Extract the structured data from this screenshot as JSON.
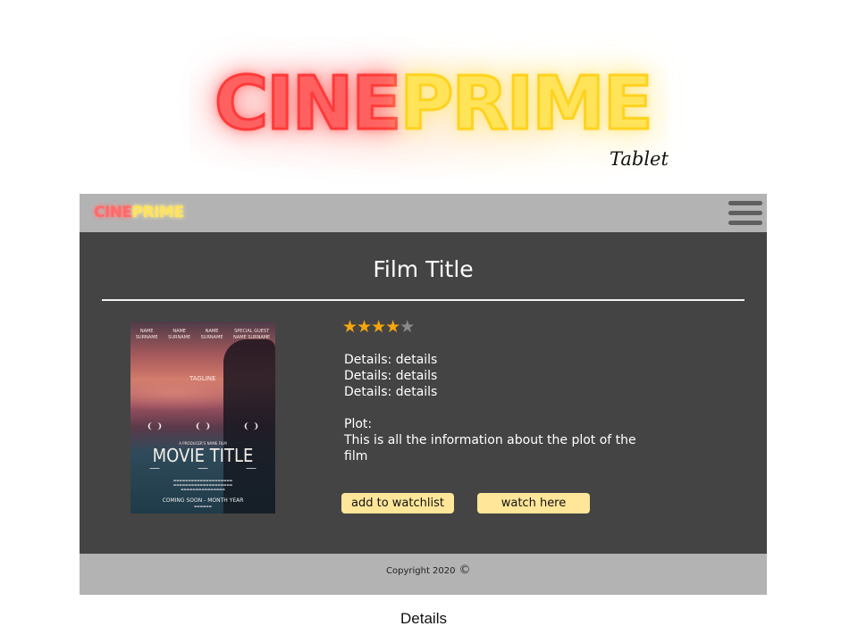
{
  "hero": {
    "logo_part1": "CINE",
    "logo_part2": "PRIME",
    "device_label": "Tablet"
  },
  "navbar": {
    "logo_part1": "CINE",
    "logo_part2": "PRIME",
    "menu_icon": "hamburger-menu-icon"
  },
  "film": {
    "title": "Film Title",
    "rating": 4,
    "rating_max": 5,
    "details": [
      "Details: details",
      "Details: details",
      "Details: details"
    ],
    "plot_label": "Plot:",
    "plot_text": "This is all the information about the plot of the film"
  },
  "poster": {
    "credits": [
      [
        "NAME",
        "SURNAME"
      ],
      [
        "NAME",
        "SURNAME"
      ],
      [
        "NAME",
        "SURNAME"
      ],
      [
        "SPECIAL GUEST",
        "NAME SURNAME"
      ]
    ],
    "tagline": "TAGLINE",
    "producer": "A PRODUCER'S NAME FILM",
    "movie_title": "MOVIE TITLE",
    "coming_soon": "COMING SOON - MONTH YEAR"
  },
  "buttons": {
    "watchlist": "add to watchlist",
    "watch": "watch here"
  },
  "footer": {
    "copyright": "Copyright 2020",
    "copyright_icon": "copyright-icon"
  },
  "caption": "Details",
  "colors": {
    "neon_red": "#ff6161",
    "neon_yellow": "#ffe45a",
    "navbar_bg": "#b3b3b3",
    "content_bg": "#444444",
    "button_bg": "#ffe699",
    "star_on": "#f5a60f",
    "star_off": "#8a8a8a"
  }
}
